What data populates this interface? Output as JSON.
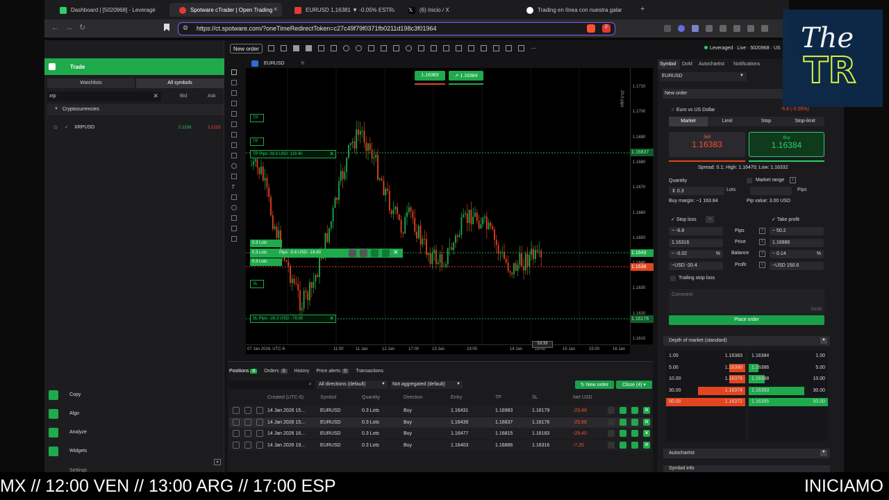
{
  "browser": {
    "tabs": [
      {
        "label": "Dashboard | [5020968] - Leveragé",
        "color": "#2bd069"
      },
      {
        "label": "Spotware cTrader | Open Trading",
        "color": "#e53935"
      },
      {
        "label": "EURUSD 1,16381 ▼ -0.05% ESTRA",
        "color": "#e53935"
      },
      {
        "label": "(6) Inicio / X",
        "color": "#ffffff"
      },
      {
        "label": "Trading en línea con nuestra galar",
        "color": "#ffffff"
      }
    ],
    "url": "https://ct.spotware.com/?oneTimeRedirectToken=c27c49f79f0371fb0211d198c3f01964",
    "badge": "2"
  },
  "app": {
    "new_order": "New order",
    "account": "Leveraged · Live · 5020968 · US",
    "left": {
      "trade": "Trade",
      "tabs": [
        "Watchlists",
        "All symbols"
      ],
      "search": "xrp",
      "bid": "Bid",
      "ask": "Ask",
      "group": "Cryptocurrencies",
      "symbol": "XRPUSD",
      "sym_bid": "2.1216",
      "sym_ask": "2.1223",
      "menu": [
        "Copy",
        "Algo",
        "Analyze",
        "Widgets"
      ],
      "settings": "Settings"
    },
    "chart": {
      "symbol": "EURUSD",
      "tf": "h",
      "sell": "1.16383",
      "buy": "1.16384",
      "pips_label": "20.0 pips",
      "y_ticks": [
        "1.1710",
        "1.1700",
        "1.1690",
        "1.1680",
        "1.1670",
        "1.1660",
        "1.1650",
        "1.1640",
        "1.1630",
        "1.1620",
        "1.1610"
      ],
      "x_ticks": [
        "07 Jan 2026, UTC-6",
        "11:00",
        "11 Jan",
        "12 Jan",
        "17:00",
        "13 Jan",
        "23:00",
        "14 Jan",
        "19:00",
        "15 Jan",
        "15:00",
        "16 Jan"
      ],
      "markers": {
        "tp1": "1.16837",
        "pos": "1.1643",
        "cur": "1.1638",
        "sl": "1.16176"
      },
      "tp_line": "Pips: 39.8  USD: 119.40",
      "pos_line": "Pips: -5.6  USD: -16.80",
      "sl_line": "Pips: -26.3  USD: -78.90",
      "lots": [
        "0.3 Lots",
        "0.3 Lots",
        "0.3 Lots"
      ],
      "time_badge": "53:33",
      "tp": "TP",
      "sl": "SL"
    },
    "right": {
      "tabs": [
        "Symbol",
        "DoM",
        "Autochartist",
        "Notifications"
      ],
      "symbol": "EURUSD",
      "new_order": "New order",
      "pair": "Euro vs US Dollar",
      "change": "-5.8 (-0.05%)",
      "order_tabs": [
        "Market",
        "Limit",
        "Stop",
        "Stop-limit"
      ],
      "sell_label": "Sell",
      "sell_price": "1.16383",
      "buy_label": "Buy",
      "buy_price": "1.16384",
      "spread": "Spread: 0.1; High: 1.16470; Low: 1.16332",
      "quantity_label": "Quantity",
      "quantity": "0.3",
      "lots": "Lots",
      "market_range": "Market range",
      "pips": "Pips",
      "margin": "Buy margin: ~1 163.84",
      "pip_value": "Pip value: 3.00 USD",
      "stop_loss": "Stop loss",
      "take_profit": "Take profit",
      "sl_pips": "-6.8",
      "tp_pips": "50.2",
      "pips_lbl": "Pips",
      "sl_price": "1.16316",
      "tp_price": "1.16886",
      "price_lbl": "Price",
      "sl_bal": "-0.02",
      "tp_bal": "0.14",
      "bal_lbl": "Balance",
      "pct": "%",
      "sl_usd": "-20.4",
      "tp_usd": "150.6",
      "usd_lbl": "~USD",
      "profit_lbl": "Profit",
      "trailing": "Trailing stop loss",
      "comment": "Comment",
      "comment_count": "0/100",
      "place": "Place order",
      "dom_title": "Depth of market (standard)",
      "dom_bids": [
        [
          "1.00",
          "1.16383"
        ],
        [
          "5.00",
          "1.16380"
        ],
        [
          "10.00",
          "1.16379"
        ],
        [
          "30.00",
          "1.16374"
        ],
        [
          "50.00",
          "1.16372"
        ]
      ],
      "dom_asks": [
        [
          "1.16384",
          "1.00"
        ],
        [
          "1.16386",
          "5.00"
        ],
        [
          "1.16388",
          "10.00"
        ],
        [
          "1.16393",
          "30.00"
        ],
        [
          "1.16395",
          "50.00"
        ]
      ],
      "autochartist": "Autochartist",
      "symbol_info": "Symbol info"
    },
    "positions": {
      "tabs": [
        {
          "label": "Positions",
          "count": "4"
        },
        {
          "label": "Orders",
          "count": "0"
        },
        {
          "label": "History",
          "count": ""
        },
        {
          "label": "Price alerts",
          "count": "0"
        },
        {
          "label": "Transactions",
          "count": ""
        }
      ],
      "dir_filter": "All directions (default)",
      "agg_filter": "Not aggregated (default)",
      "new_order": "New order",
      "close": "Close (4)",
      "headers": [
        "Created (UTC-6)",
        "Symbol",
        "Quantity",
        "Direction",
        "Entry",
        "TP",
        "SL",
        "Net USD"
      ],
      "rows": [
        [
          "14 Jan 2026 15...",
          "EURUSD",
          "0.3 Lots",
          "Buy",
          "1.16431",
          "1.16983",
          "1.16179",
          "-23.48"
        ],
        [
          "14 Jan 2026 15...",
          "EURUSD",
          "0.3 Lots",
          "Buy",
          "1.16439",
          "1.16837",
          "1.16176",
          "-25.88"
        ],
        [
          "14 Jan 2026 16...",
          "EURUSD",
          "0.3 Lots",
          "Buy",
          "1.16477",
          "1.16815",
          "1.16183",
          "-29.40"
        ],
        [
          "14 Jan 2026 19...",
          "EURUSD",
          "0.3 Lots",
          "Buy",
          "1.16403",
          "1.16886",
          "1.16316",
          "-7.20"
        ]
      ]
    }
  },
  "overlay": {
    "logo": "The TR"
  },
  "ticker": {
    "left": "MX // 12:00 VEN // 13:00 ARG // 17:00 ESP",
    "right": "INICIAMO"
  }
}
